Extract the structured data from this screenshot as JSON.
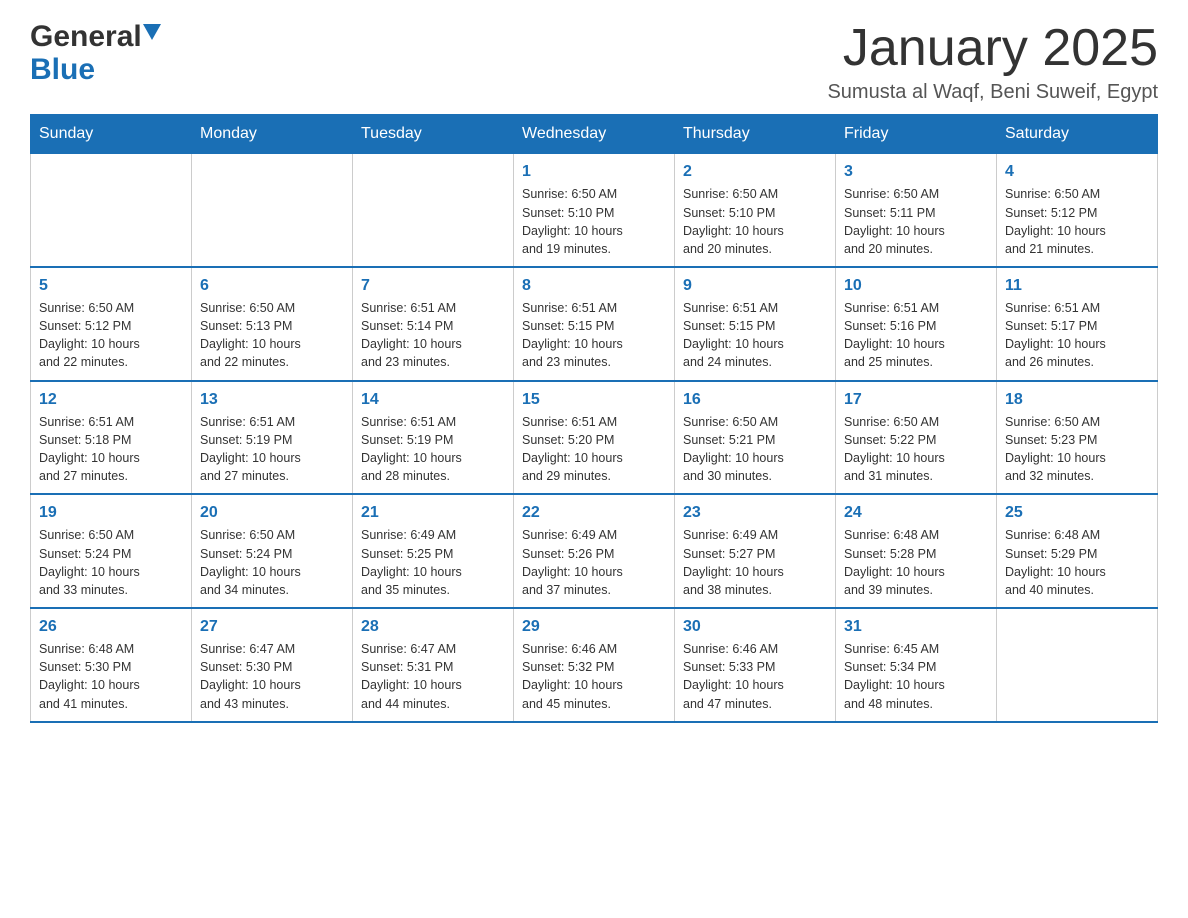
{
  "header": {
    "logo_general": "General",
    "logo_blue": "Blue",
    "month_title": "January 2025",
    "location": "Sumusta al Waqf, Beni Suweif, Egypt"
  },
  "days_of_week": [
    "Sunday",
    "Monday",
    "Tuesday",
    "Wednesday",
    "Thursday",
    "Friday",
    "Saturday"
  ],
  "weeks": [
    [
      {
        "day": "",
        "info": ""
      },
      {
        "day": "",
        "info": ""
      },
      {
        "day": "",
        "info": ""
      },
      {
        "day": "1",
        "info": "Sunrise: 6:50 AM\nSunset: 5:10 PM\nDaylight: 10 hours\nand 19 minutes."
      },
      {
        "day": "2",
        "info": "Sunrise: 6:50 AM\nSunset: 5:10 PM\nDaylight: 10 hours\nand 20 minutes."
      },
      {
        "day": "3",
        "info": "Sunrise: 6:50 AM\nSunset: 5:11 PM\nDaylight: 10 hours\nand 20 minutes."
      },
      {
        "day": "4",
        "info": "Sunrise: 6:50 AM\nSunset: 5:12 PM\nDaylight: 10 hours\nand 21 minutes."
      }
    ],
    [
      {
        "day": "5",
        "info": "Sunrise: 6:50 AM\nSunset: 5:12 PM\nDaylight: 10 hours\nand 22 minutes."
      },
      {
        "day": "6",
        "info": "Sunrise: 6:50 AM\nSunset: 5:13 PM\nDaylight: 10 hours\nand 22 minutes."
      },
      {
        "day": "7",
        "info": "Sunrise: 6:51 AM\nSunset: 5:14 PM\nDaylight: 10 hours\nand 23 minutes."
      },
      {
        "day": "8",
        "info": "Sunrise: 6:51 AM\nSunset: 5:15 PM\nDaylight: 10 hours\nand 23 minutes."
      },
      {
        "day": "9",
        "info": "Sunrise: 6:51 AM\nSunset: 5:15 PM\nDaylight: 10 hours\nand 24 minutes."
      },
      {
        "day": "10",
        "info": "Sunrise: 6:51 AM\nSunset: 5:16 PM\nDaylight: 10 hours\nand 25 minutes."
      },
      {
        "day": "11",
        "info": "Sunrise: 6:51 AM\nSunset: 5:17 PM\nDaylight: 10 hours\nand 26 minutes."
      }
    ],
    [
      {
        "day": "12",
        "info": "Sunrise: 6:51 AM\nSunset: 5:18 PM\nDaylight: 10 hours\nand 27 minutes."
      },
      {
        "day": "13",
        "info": "Sunrise: 6:51 AM\nSunset: 5:19 PM\nDaylight: 10 hours\nand 27 minutes."
      },
      {
        "day": "14",
        "info": "Sunrise: 6:51 AM\nSunset: 5:19 PM\nDaylight: 10 hours\nand 28 minutes."
      },
      {
        "day": "15",
        "info": "Sunrise: 6:51 AM\nSunset: 5:20 PM\nDaylight: 10 hours\nand 29 minutes."
      },
      {
        "day": "16",
        "info": "Sunrise: 6:50 AM\nSunset: 5:21 PM\nDaylight: 10 hours\nand 30 minutes."
      },
      {
        "day": "17",
        "info": "Sunrise: 6:50 AM\nSunset: 5:22 PM\nDaylight: 10 hours\nand 31 minutes."
      },
      {
        "day": "18",
        "info": "Sunrise: 6:50 AM\nSunset: 5:23 PM\nDaylight: 10 hours\nand 32 minutes."
      }
    ],
    [
      {
        "day": "19",
        "info": "Sunrise: 6:50 AM\nSunset: 5:24 PM\nDaylight: 10 hours\nand 33 minutes."
      },
      {
        "day": "20",
        "info": "Sunrise: 6:50 AM\nSunset: 5:24 PM\nDaylight: 10 hours\nand 34 minutes."
      },
      {
        "day": "21",
        "info": "Sunrise: 6:49 AM\nSunset: 5:25 PM\nDaylight: 10 hours\nand 35 minutes."
      },
      {
        "day": "22",
        "info": "Sunrise: 6:49 AM\nSunset: 5:26 PM\nDaylight: 10 hours\nand 37 minutes."
      },
      {
        "day": "23",
        "info": "Sunrise: 6:49 AM\nSunset: 5:27 PM\nDaylight: 10 hours\nand 38 minutes."
      },
      {
        "day": "24",
        "info": "Sunrise: 6:48 AM\nSunset: 5:28 PM\nDaylight: 10 hours\nand 39 minutes."
      },
      {
        "day": "25",
        "info": "Sunrise: 6:48 AM\nSunset: 5:29 PM\nDaylight: 10 hours\nand 40 minutes."
      }
    ],
    [
      {
        "day": "26",
        "info": "Sunrise: 6:48 AM\nSunset: 5:30 PM\nDaylight: 10 hours\nand 41 minutes."
      },
      {
        "day": "27",
        "info": "Sunrise: 6:47 AM\nSunset: 5:30 PM\nDaylight: 10 hours\nand 43 minutes."
      },
      {
        "day": "28",
        "info": "Sunrise: 6:47 AM\nSunset: 5:31 PM\nDaylight: 10 hours\nand 44 minutes."
      },
      {
        "day": "29",
        "info": "Sunrise: 6:46 AM\nSunset: 5:32 PM\nDaylight: 10 hours\nand 45 minutes."
      },
      {
        "day": "30",
        "info": "Sunrise: 6:46 AM\nSunset: 5:33 PM\nDaylight: 10 hours\nand 47 minutes."
      },
      {
        "day": "31",
        "info": "Sunrise: 6:45 AM\nSunset: 5:34 PM\nDaylight: 10 hours\nand 48 minutes."
      },
      {
        "day": "",
        "info": ""
      }
    ]
  ]
}
